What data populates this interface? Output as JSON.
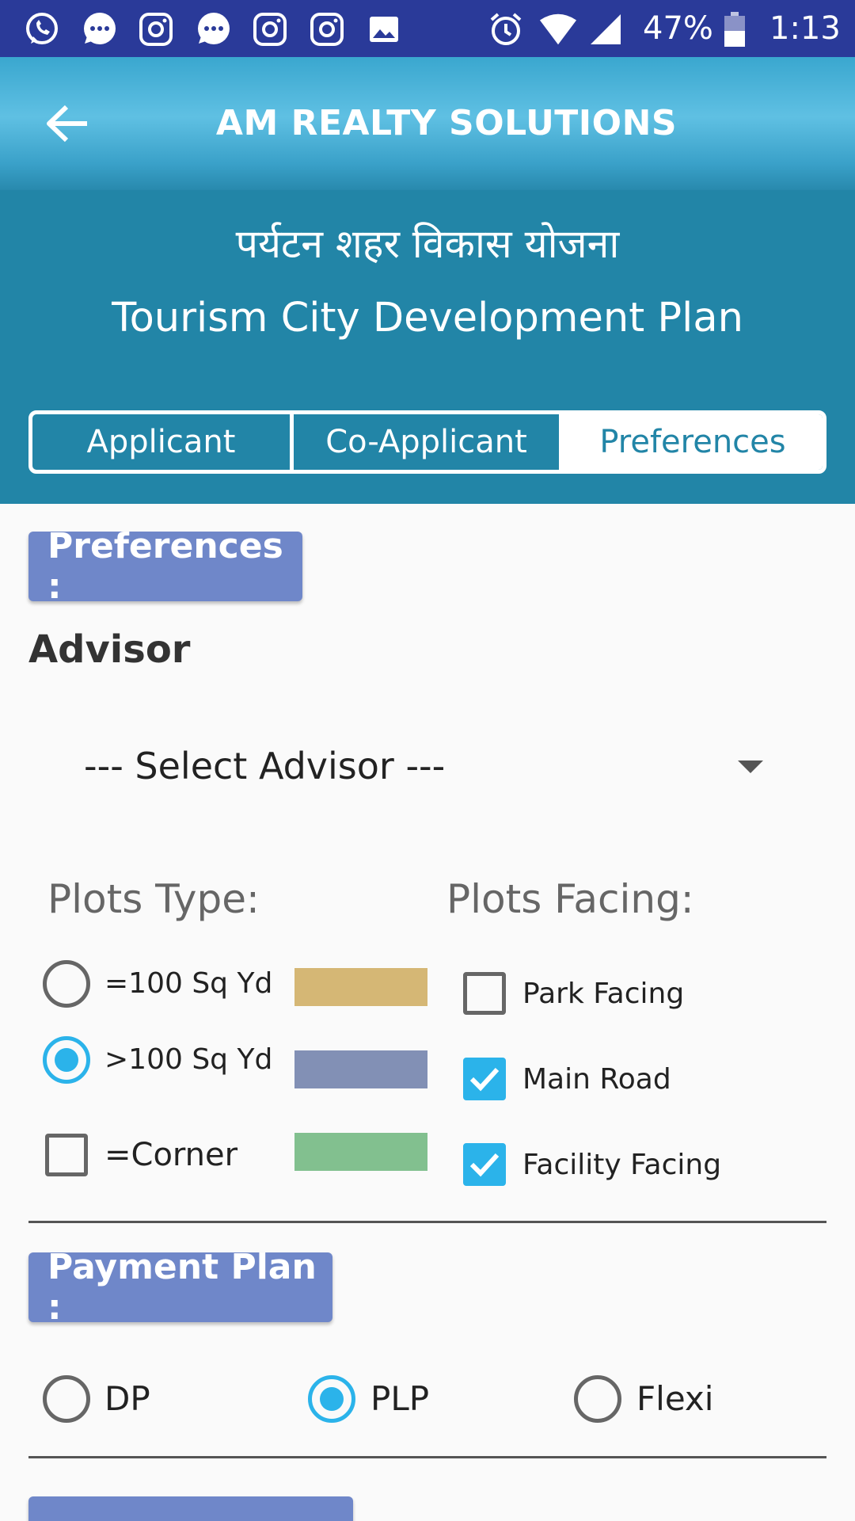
{
  "status_bar": {
    "battery": "47%",
    "time": "1:13",
    "icons": [
      "whatsapp-icon",
      "message-icon",
      "instagram-icon",
      "message-icon",
      "instagram-icon",
      "instagram-icon",
      "image-icon",
      "alarm-icon",
      "wifi-icon",
      "signal-icon",
      "battery-icon"
    ]
  },
  "app_bar": {
    "title": "AM REALTY SOLUTIONS",
    "back_icon": "arrow-left-icon"
  },
  "header": {
    "hindi_title": "पर्यटन शहर विकास योजना",
    "english_title": "Tourism City Development Plan"
  },
  "tabs": [
    {
      "label": "Applicant",
      "active": false
    },
    {
      "label": "Co-Applicant",
      "active": false
    },
    {
      "label": "Preferences",
      "active": true
    }
  ],
  "preferences": {
    "section_label": "Preferences :",
    "advisor_label": "Advisor",
    "advisor_select": {
      "selected": "--- Select Advisor ---"
    },
    "plots_type_label": "Plots Type:",
    "plots_facing_label": "Plots Facing:",
    "plot_types": [
      {
        "label": "=100 Sq Yd",
        "control": "radio",
        "checked": false,
        "color": "#d5b775"
      },
      {
        "label": ">100 Sq Yd",
        "control": "radio",
        "checked": true,
        "color": "#8290b5"
      },
      {
        "label": "=Corner",
        "control": "checkbox",
        "checked": false,
        "color": "#82c08f"
      }
    ],
    "plot_facing": [
      {
        "label": "Park Facing",
        "checked": false
      },
      {
        "label": "Main Road",
        "checked": true
      },
      {
        "label": "Facility Facing",
        "checked": true
      }
    ]
  },
  "payment": {
    "section_label": "Payment Plan :",
    "options": [
      {
        "label": "DP",
        "checked": false
      },
      {
        "label": "PLP",
        "checked": true
      },
      {
        "label": "Flexi",
        "checked": false
      }
    ]
  },
  "colors": {
    "status_bar": "#2a3a99",
    "header": "#2285a7",
    "section_tag": "#6f87c9",
    "accent": "#2bb3ea"
  }
}
